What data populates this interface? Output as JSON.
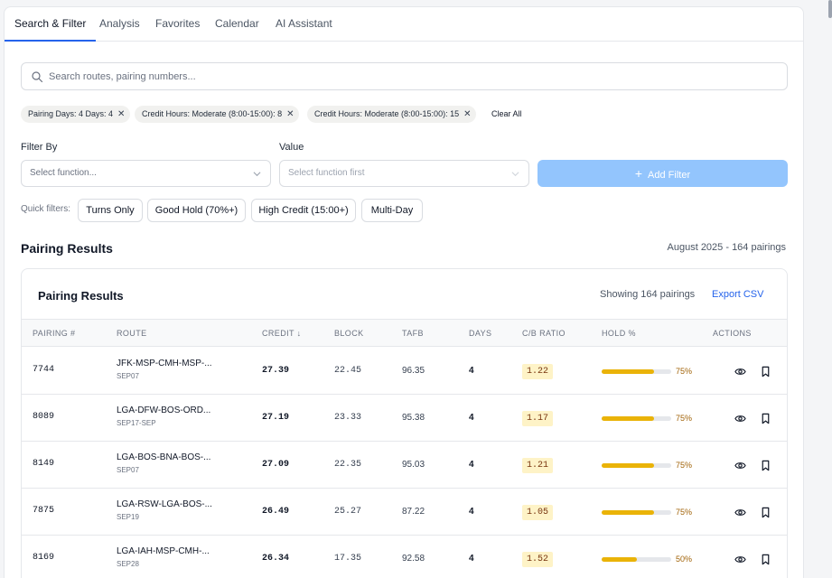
{
  "tabs": [
    {
      "label": "Search & Filter",
      "active": true
    },
    {
      "label": "Analysis",
      "active": false
    },
    {
      "label": "Favorites",
      "active": false
    },
    {
      "label": "Calendar",
      "active": false
    },
    {
      "label": "AI Assistant",
      "active": false
    }
  ],
  "search": {
    "placeholder": "Search routes, pairing numbers..."
  },
  "active_filters": [
    {
      "label": "Pairing Days: 4 Days: 4"
    },
    {
      "label": "Credit Hours: Moderate (8:00-15:00): 8"
    },
    {
      "label": "Credit Hours: Moderate (8:00-15:00): 15"
    }
  ],
  "clear_all_label": "Clear All",
  "filter": {
    "filter_by_label": "Filter By",
    "value_label": "Value",
    "function_placeholder": "Select function...",
    "value_placeholder": "Select function first",
    "add_button_label": "Add Filter",
    "add_icon": "plus-icon"
  },
  "quick_filters": {
    "label": "Quick filters:",
    "buttons": [
      "Turns Only",
      "Good Hold (70%+)",
      "High Credit (15:00+)",
      "Multi-Day"
    ]
  },
  "section": {
    "title": "Pairing Results",
    "meta": "August 2025 - 164 pairings"
  },
  "results": {
    "title": "Pairing Results",
    "showing": "Showing 164 pairings",
    "export_label": "Export CSV",
    "columns": [
      "PAIRING #",
      "ROUTE",
      "CREDIT ↓",
      "BLOCK",
      "TAFB",
      "DAYS",
      "C/B RATIO",
      "HOLD %",
      "ACTIONS"
    ],
    "rows": [
      {
        "pairing": "7744",
        "route": "JFK-MSP-CMH-MSP-...",
        "date": "SEP07",
        "credit": "27.39",
        "block": "22.45",
        "tafb": "96.35",
        "days": "4",
        "cb": "1.22",
        "hold": "75%",
        "hold_value": 0.75
      },
      {
        "pairing": "8089",
        "route": "LGA-DFW-BOS-ORD...",
        "date": "SEP17-SEP",
        "credit": "27.19",
        "block": "23.33",
        "tafb": "95.38",
        "days": "4",
        "cb": "1.17",
        "hold": "75%",
        "hold_value": 0.75
      },
      {
        "pairing": "8149",
        "route": "LGA-BOS-BNA-BOS-...",
        "date": "SEP07",
        "credit": "27.09",
        "block": "22.35",
        "tafb": "95.03",
        "days": "4",
        "cb": "1.21",
        "hold": "75%",
        "hold_value": 0.75
      },
      {
        "pairing": "7875",
        "route": "LGA-RSW-LGA-BOS-...",
        "date": "SEP19",
        "credit": "26.49",
        "block": "25.27",
        "tafb": "87.22",
        "days": "4",
        "cb": "1.05",
        "hold": "75%",
        "hold_value": 0.75
      },
      {
        "pairing": "8169",
        "route": "LGA-IAH-MSP-CMH-...",
        "date": "SEP28",
        "credit": "26.34",
        "block": "17.35",
        "tafb": "92.58",
        "days": "4",
        "cb": "1.52",
        "hold": "50%",
        "hold_value": 0.5
      }
    ],
    "action_icons": [
      "eye-icon",
      "bookmark-icon"
    ]
  },
  "colors": {
    "accent": "#2563eb",
    "add_button": "#93c5fd",
    "hold_bar": "#eab308",
    "cb_badge": "#fef3c7"
  }
}
